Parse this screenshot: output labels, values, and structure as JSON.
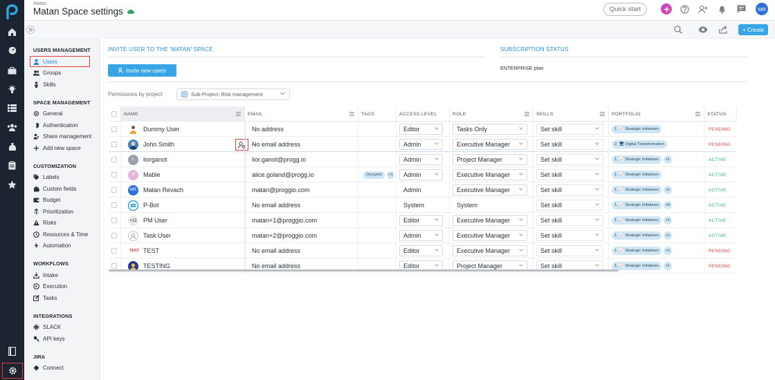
{
  "header": {
    "breadcrumb": "Matan",
    "title": "Matan Space settings",
    "quick_start": "Quick start",
    "avatar_initials": "MR"
  },
  "toolbar": {
    "create_label": "+ Create"
  },
  "sidebar": {
    "sections": [
      {
        "title": "USERS MANAGEMENT",
        "items": [
          {
            "label": "Users",
            "icon": "user-icon",
            "active": true
          },
          {
            "label": "Groups",
            "icon": "users-icon"
          },
          {
            "label": "Skills",
            "icon": "person-icon"
          }
        ]
      },
      {
        "title": "SPACE MANAGEMENT",
        "items": [
          {
            "label": "General",
            "icon": "gear-icon"
          },
          {
            "label": "Authentication",
            "icon": "shield-icon"
          },
          {
            "label": "Share management",
            "icon": "share-icon"
          },
          {
            "label": "Add new space",
            "icon": "plus-icon"
          }
        ]
      },
      {
        "title": "CUSTOMIZATION",
        "items": [
          {
            "label": "Labels",
            "icon": "tag-icon"
          },
          {
            "label": "Custom fields",
            "icon": "puzzle-icon"
          },
          {
            "label": "Budget",
            "icon": "wallet-icon"
          },
          {
            "label": "Prioritization",
            "icon": "priority-icon"
          },
          {
            "label": "Risks",
            "icon": "warning-icon"
          },
          {
            "label": "Resources & Time",
            "icon": "clock-icon"
          },
          {
            "label": "Automation",
            "icon": "lightning-icon"
          }
        ]
      },
      {
        "title": "WORKFLOWS",
        "items": [
          {
            "label": "Intake",
            "icon": "intake-icon"
          },
          {
            "label": "Execution",
            "icon": "execution-icon"
          },
          {
            "label": "Tasks",
            "icon": "edit-icon"
          }
        ]
      },
      {
        "title": "INTEGRATIONS",
        "items": [
          {
            "label": "SLACK",
            "icon": "slack-icon"
          },
          {
            "label": "API keys",
            "icon": "key-icon"
          }
        ]
      },
      {
        "title": "JIRA",
        "items": [
          {
            "label": "Connect",
            "icon": "diamond-icon"
          }
        ]
      }
    ]
  },
  "invite": {
    "title": "INVITE USER TO THE 'MATAN' SPACE",
    "button": "Invite new users",
    "permissions_label": "Permissions by project",
    "permissions_value": "Sub-Project: Risk management"
  },
  "subscription": {
    "title": "SUBSCRIPTION STATUS",
    "plan": "ENTERPRISE plan"
  },
  "table": {
    "columns": [
      "NAME",
      "EMAIL",
      "TAGS",
      "ACCESS LEVEL",
      "ROLE",
      "SKILLS",
      "PORTFOLIO",
      "STATUS"
    ],
    "rows": [
      {
        "name": "Dummy User",
        "avatar": "",
        "avatar_color": "#f0b648",
        "email": "No address",
        "tags": [],
        "access": "Editor",
        "access_dropdown": true,
        "role": "Tasks Only",
        "role_dropdown": true,
        "skills": "Set skill",
        "portfolio": "1. 📈 Strategic Initiatives",
        "portfolio_more": "",
        "status": "PENDING"
      },
      {
        "name": "John Smith",
        "avatar": "",
        "avatar_color": "#3b86c9",
        "email": "No email address",
        "tags": [],
        "access": "Admin",
        "access_dropdown": true,
        "role": "Executive Manager",
        "role_dropdown": true,
        "skills": "Set skill",
        "portfolio": "2. 🖥 Digital Transformation",
        "portfolio_more": "",
        "status": "PENDING"
      },
      {
        "name": "liorganot",
        "avatar": "L",
        "avatar_color": "#9aa0a8",
        "email": "lior.ganot@progg.io",
        "tags": [],
        "access": "Admin",
        "access_dropdown": true,
        "role": "Project Manager",
        "role_dropdown": true,
        "skills": "Set skill",
        "portfolio": "1. 📈 Strategic Initiatives",
        "portfolio_more": "+1",
        "status": "ACTIVE"
      },
      {
        "name": "Mable",
        "avatar": "M",
        "avatar_color": "#e5b3dc",
        "email": "alice.goland@progg.io",
        "tags": [
          "Designer",
          "+1"
        ],
        "access": "Admin",
        "access_dropdown": true,
        "role": "Executive Manager",
        "role_dropdown": true,
        "skills": "Set skill",
        "portfolio": "1. 📈 Strategic Initiatives",
        "portfolio_more": "",
        "status": "ACTIVE"
      },
      {
        "name": "Matan Revach",
        "avatar": "MR",
        "avatar_color": "#2f6fdc",
        "email": "matan@proggio.com",
        "tags": [],
        "access": "Admin",
        "access_dropdown": false,
        "role": "Executive Manager",
        "role_dropdown": true,
        "skills": "Set skill",
        "portfolio": "1. 📈 Strategic Initiatives",
        "portfolio_more": "+1",
        "status": "ACTIVE"
      },
      {
        "name": "P-Bot",
        "avatar": "",
        "avatar_color": "#3aa3de",
        "email": "No email address",
        "tags": [],
        "access": "System",
        "access_dropdown": false,
        "role": "System",
        "role_dropdown": false,
        "skills": "Set skill",
        "portfolio": "1. 📈 Strategic Initiatives",
        "portfolio_more": "+5",
        "status": "ACTIVE"
      },
      {
        "name": "PM User",
        "avatar": "+11",
        "avatar_color": "#e7e9ec",
        "email": "matan+1@proggio.com",
        "tags": [],
        "access": "Editor",
        "access_dropdown": true,
        "role": "Executive Manager",
        "role_dropdown": true,
        "skills": "Set skill",
        "portfolio": "1. 📈 Strategic Initiatives",
        "portfolio_more": "+1",
        "status": "ACTIVE"
      },
      {
        "name": "Task User",
        "avatar": "",
        "avatar_color": "#eceef1",
        "email": "matan+2@proggio.com",
        "tags": [],
        "access": "Admin",
        "access_dropdown": true,
        "role": "Executive Manager",
        "role_dropdown": true,
        "skills": "Set skill",
        "portfolio": "1. 📈 Strategic Initiatives",
        "portfolio_more": "+1",
        "status": "ACTIVE"
      },
      {
        "name": "TEST",
        "avatar": "TEST",
        "avatar_color": "#ffffff",
        "email": "No email address",
        "tags": [],
        "access": "Editor",
        "access_dropdown": true,
        "role": "Executive Manager",
        "role_dropdown": true,
        "skills": "Set skill",
        "portfolio": "1. 📈 Strategic Initiatives",
        "portfolio_more": "+1",
        "status": "PENDING"
      },
      {
        "name": "TESTING",
        "avatar": "",
        "avatar_color": "#2c3a8c",
        "email": "No email address",
        "tags": [],
        "access": "Editor",
        "access_dropdown": true,
        "role": "Project Manager",
        "role_dropdown": true,
        "skills": "Set skill",
        "portfolio": "1. 📈 Strategic Initiatives",
        "portfolio_more": "+1",
        "status": "PENDING"
      }
    ]
  },
  "colors": {
    "accent": "#38a5e6",
    "pending": "#e5484d",
    "active": "#2fb38a",
    "highlight": "#e03c3c",
    "rail": "#1d2431"
  }
}
